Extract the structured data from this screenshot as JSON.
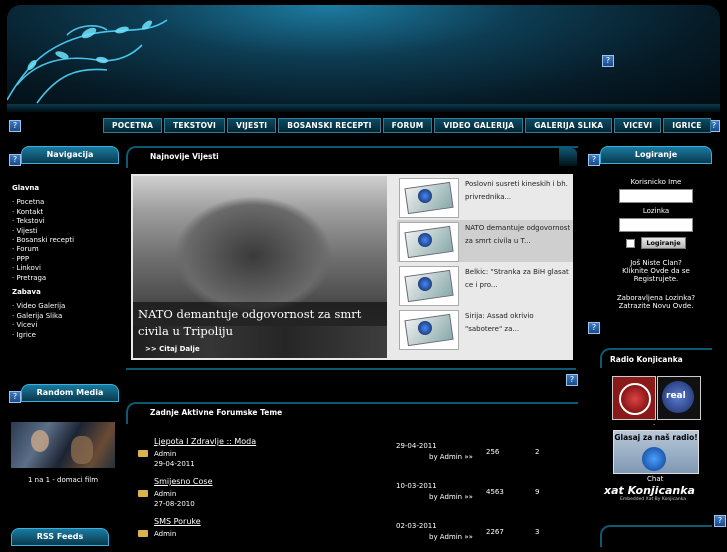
{
  "nav": [
    "POCETNA",
    "TEKSTOVI",
    "VIJESTI",
    "BOSANSKI RECEPTI",
    "FORUM",
    "VIDEO GALERIJA",
    "GALERIJA SLIKA",
    "VICEVI",
    "IGRICE"
  ],
  "navigacija": {
    "title": "Navigacija",
    "glavna": "Glavna",
    "glavna_items": [
      "· Pocetna",
      "· Kontakt",
      "· Tekstovi",
      "· Vijesti",
      "· Bosanski recepti",
      "· Forum",
      "· PPP",
      "· Linkovi",
      "· Pretraga"
    ],
    "zabava": "Zabava",
    "zabava_items": [
      "· Video Galerija",
      "· Galerija Slika",
      "· Vicevi",
      "· Igrice"
    ]
  },
  "random_media": {
    "title": "Random Media",
    "caption": "1 na 1 - domaci film"
  },
  "rss": {
    "title": "RSS Feeds"
  },
  "news": {
    "title": "Najnovije Vijesti",
    "feature_title": "NATO demantuje odgovornost za smrt civila u Tripoliju",
    "read_more": ">> Citaj Dalje",
    "items": [
      "Poslovni susreti kineskih i bh. privrednika...",
      "NATO demantuje odgovornost za smrt civila u T...",
      "Belkic: \"Stranka za BiH glasat ce i pro...",
      "Sirija: Assad okrivio \"sabotere\" za..."
    ]
  },
  "forum": {
    "title": "Zadnje Aktivne Forumske Teme",
    "topics": [
      {
        "name": "Ljepota I Zdravlje :: Moda",
        "author": "Admin",
        "date": "29-04-2011",
        "last_date": "29-04-2011",
        "last_by": "by Admin »»",
        "views": "256",
        "replies": "2"
      },
      {
        "name": "Smijesno Cose",
        "author": "Admin",
        "date": "27-08-2010",
        "last_date": "10-03-2011",
        "last_by": "by Admin »»",
        "views": "4563",
        "replies": "9"
      },
      {
        "name": "SMS Poruke",
        "author": "Admin",
        "date": "",
        "last_date": "02-03-2011",
        "last_by": "by Admin »»",
        "views": "2267",
        "replies": "3"
      }
    ]
  },
  "login": {
    "title": "Logiranje",
    "username_label": "Korisnicko Ime",
    "password_label": "Lozinka",
    "submit": "Logiranje",
    "not_member": "Još Niste Clan?",
    "register": "Kliknite Ovde da se Registrujete.",
    "forgot": "Zaboravljena Lozinka?",
    "new_pass": "Zatrazite Novu Ovde."
  },
  "radio": {
    "title": "Radio Konjicanka",
    "dot": ".",
    "vote": "Glasaj za naš radio!",
    "chat": "Chat",
    "xat_brand": "xat Konjicanka",
    "xat_sub": "Embedded Xat By Konjicanka"
  },
  "icons": {
    "help": "?"
  }
}
